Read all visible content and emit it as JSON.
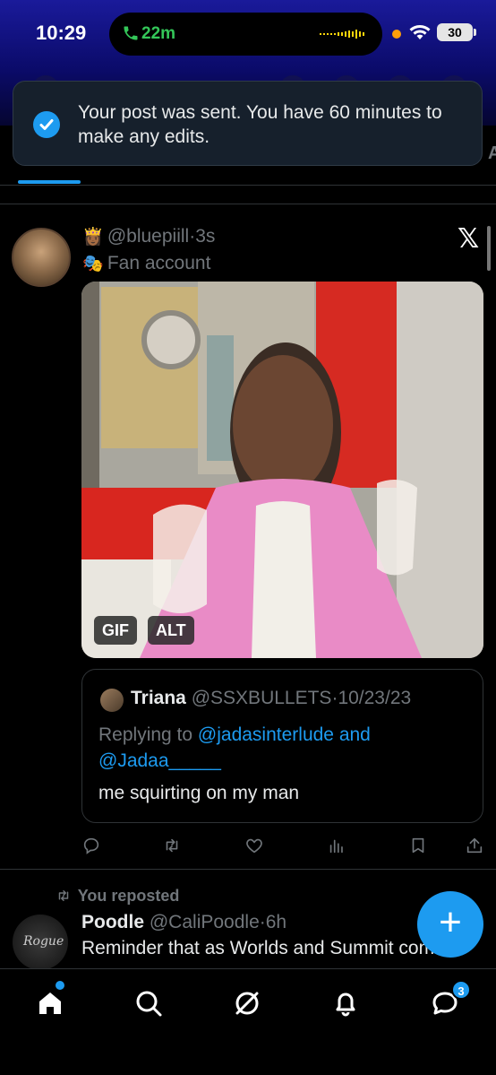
{
  "status_bar": {
    "time": "10:29",
    "call_timer": "22m",
    "battery": "30"
  },
  "toast": {
    "message": "Your post was sent. You have 60 minutes to make any edits."
  },
  "edge_letter": "A",
  "tweet": {
    "handle": "@bluepiill",
    "separator": "·",
    "time": "3s",
    "emoji_crown": "👸🏾",
    "emoji_mask": "🎭",
    "subtitle": "Fan account",
    "media": {
      "gif_badge": "GIF",
      "alt_badge": "ALT"
    },
    "quote": {
      "name": "Triana",
      "handle": "@SSXBULLETS",
      "date": "10/23/23",
      "replying_to": "Replying to",
      "mention_1": "@jadasinterlude and",
      "mention_2": "@Jadaa_____",
      "body": "me squirting on my man"
    }
  },
  "tweet2": {
    "repost_label": "You reposted",
    "name": "Poodle",
    "handle": "@CaliPoodle",
    "time": "6h",
    "body": "Reminder that as Worlds and Summit come",
    "avatar_text": "Rogue"
  },
  "fab": {
    "label": "+"
  },
  "nav": {
    "messages_badge": "3"
  },
  "colors": {
    "accent": "#1d9bf0",
    "background": "#000000",
    "muted": "#71767b",
    "call_green": "#34c759"
  }
}
